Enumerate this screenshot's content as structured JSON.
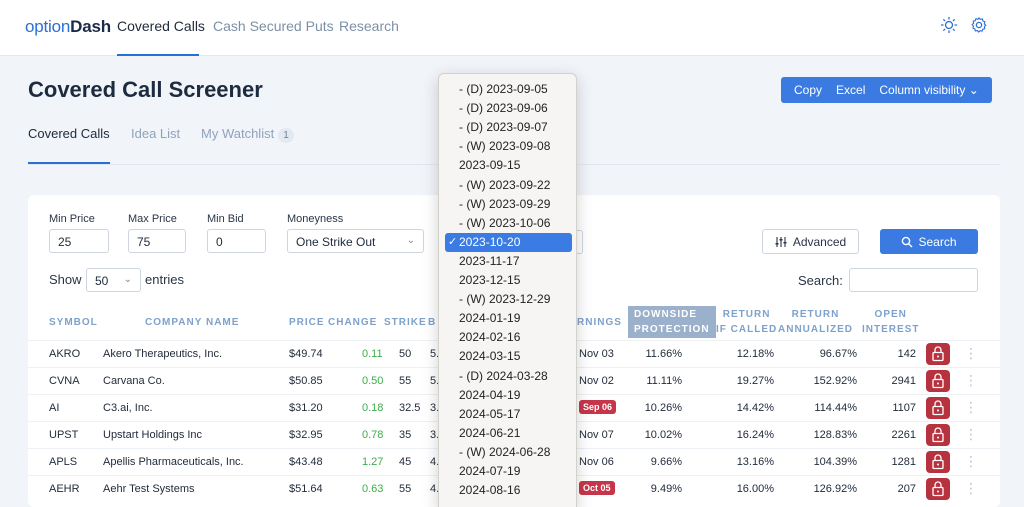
{
  "brand": {
    "prefix": "option",
    "suffix": "Dash"
  },
  "nav": [
    "Covered Calls",
    "Cash Secured Puts",
    "Research"
  ],
  "page_title": "Covered Call Screener",
  "actions": [
    "Copy",
    "Excel",
    "Column visibility ⌄"
  ],
  "subtabs": {
    "covered_calls": "Covered Calls",
    "idea_list": "Idea List",
    "watchlist": "My Watchlist",
    "watchlist_count": "1"
  },
  "filters": {
    "min_price_label": "Min Price",
    "min_price": "25",
    "max_price_label": "Max Price",
    "max_price": "75",
    "min_bid_label": "Min Bid",
    "min_bid": "0",
    "moneyness_label": "Moneyness",
    "moneyness": "One Strike Out"
  },
  "advanced_label": "Advanced",
  "search_button": "Search",
  "show_label": "Show",
  "entries_value": "50",
  "entries_label": "entries",
  "search_label": "Search:",
  "columns": {
    "symbol": "SYMBOL",
    "company": "COMPANY NAME",
    "price": "PRICE",
    "change": "CHANGE",
    "strike": "STRIKE",
    "bid": "B",
    "earnings": "RNINGS",
    "downside_1": "DOWNSIDE",
    "downside_2": "PROTECTION",
    "return_called_1": "RETURN",
    "return_called_2": "IF CALLED",
    "return_ann_1": "RETURN",
    "return_ann_2": "ANNUALIZED",
    "oi_1": "OPEN",
    "oi_2": "INTEREST"
  },
  "rows": [
    {
      "symbol": "AKRO",
      "company": "Akero Therapeutics, Inc.",
      "price": "$49.74",
      "change": "0.11",
      "strike": "50",
      "bid": "5.",
      "earnings": "Nov 03",
      "earnings_alert": false,
      "downside": "11.66%",
      "ret_called": "12.18%",
      "ret_ann": "96.67%",
      "oi": "142"
    },
    {
      "symbol": "CVNA",
      "company": "Carvana Co.",
      "price": "$50.85",
      "change": "0.50",
      "strike": "55",
      "bid": "5.",
      "earnings": "Nov 02",
      "earnings_alert": false,
      "downside": "11.11%",
      "ret_called": "19.27%",
      "ret_ann": "152.92%",
      "oi": "2941"
    },
    {
      "symbol": "AI",
      "company": "C3.ai, Inc.",
      "price": "$31.20",
      "change": "0.18",
      "strike": "32.5",
      "bid": "3.",
      "earnings": "Sep 06",
      "earnings_alert": true,
      "downside": "10.26%",
      "ret_called": "14.42%",
      "ret_ann": "114.44%",
      "oi": "1107"
    },
    {
      "symbol": "UPST",
      "company": "Upstart Holdings Inc",
      "price": "$32.95",
      "change": "0.78",
      "strike": "35",
      "bid": "3.",
      "earnings": "Nov 07",
      "earnings_alert": false,
      "downside": "10.02%",
      "ret_called": "16.24%",
      "ret_ann": "128.83%",
      "oi": "2261"
    },
    {
      "symbol": "APLS",
      "company": "Apellis Pharmaceuticals, Inc.",
      "price": "$43.48",
      "change": "1.27",
      "strike": "45",
      "bid": "4.",
      "earnings": "Nov 06",
      "earnings_alert": false,
      "downside": "9.66%",
      "ret_called": "13.16%",
      "ret_ann": "104.39%",
      "oi": "1281"
    },
    {
      "symbol": "AEHR",
      "company": "Aehr Test Systems",
      "price": "$51.64",
      "change": "0.63",
      "strike": "55",
      "bid": "4.",
      "earnings": "Oct 05",
      "earnings_alert": true,
      "downside": "9.49%",
      "ret_called": "16.00%",
      "ret_ann": "126.92%",
      "oi": "207"
    }
  ],
  "expiry_options": [
    "- (D) 2023-09-05",
    "- (D) 2023-09-06",
    "- (D) 2023-09-07",
    "- (W) 2023-09-08",
    "2023-09-15",
    "- (W) 2023-09-22",
    "- (W) 2023-09-29",
    "- (W) 2023-10-06",
    "2023-10-20",
    "2023-11-17",
    "2023-12-15",
    "- (W) 2023-12-29",
    "2024-01-19",
    "2024-02-16",
    "2024-03-15",
    "- (D) 2024-03-28",
    "2024-04-19",
    "2024-05-17",
    "2024-06-21",
    "- (W) 2024-06-28",
    "2024-07-19",
    "2024-08-16"
  ],
  "selected_expiry": "2023-10-20",
  "colors": {
    "accent": "#3b7ae0",
    "positive": "#3cae4a",
    "alert": "#c6364a",
    "lock": "#b6323e"
  }
}
